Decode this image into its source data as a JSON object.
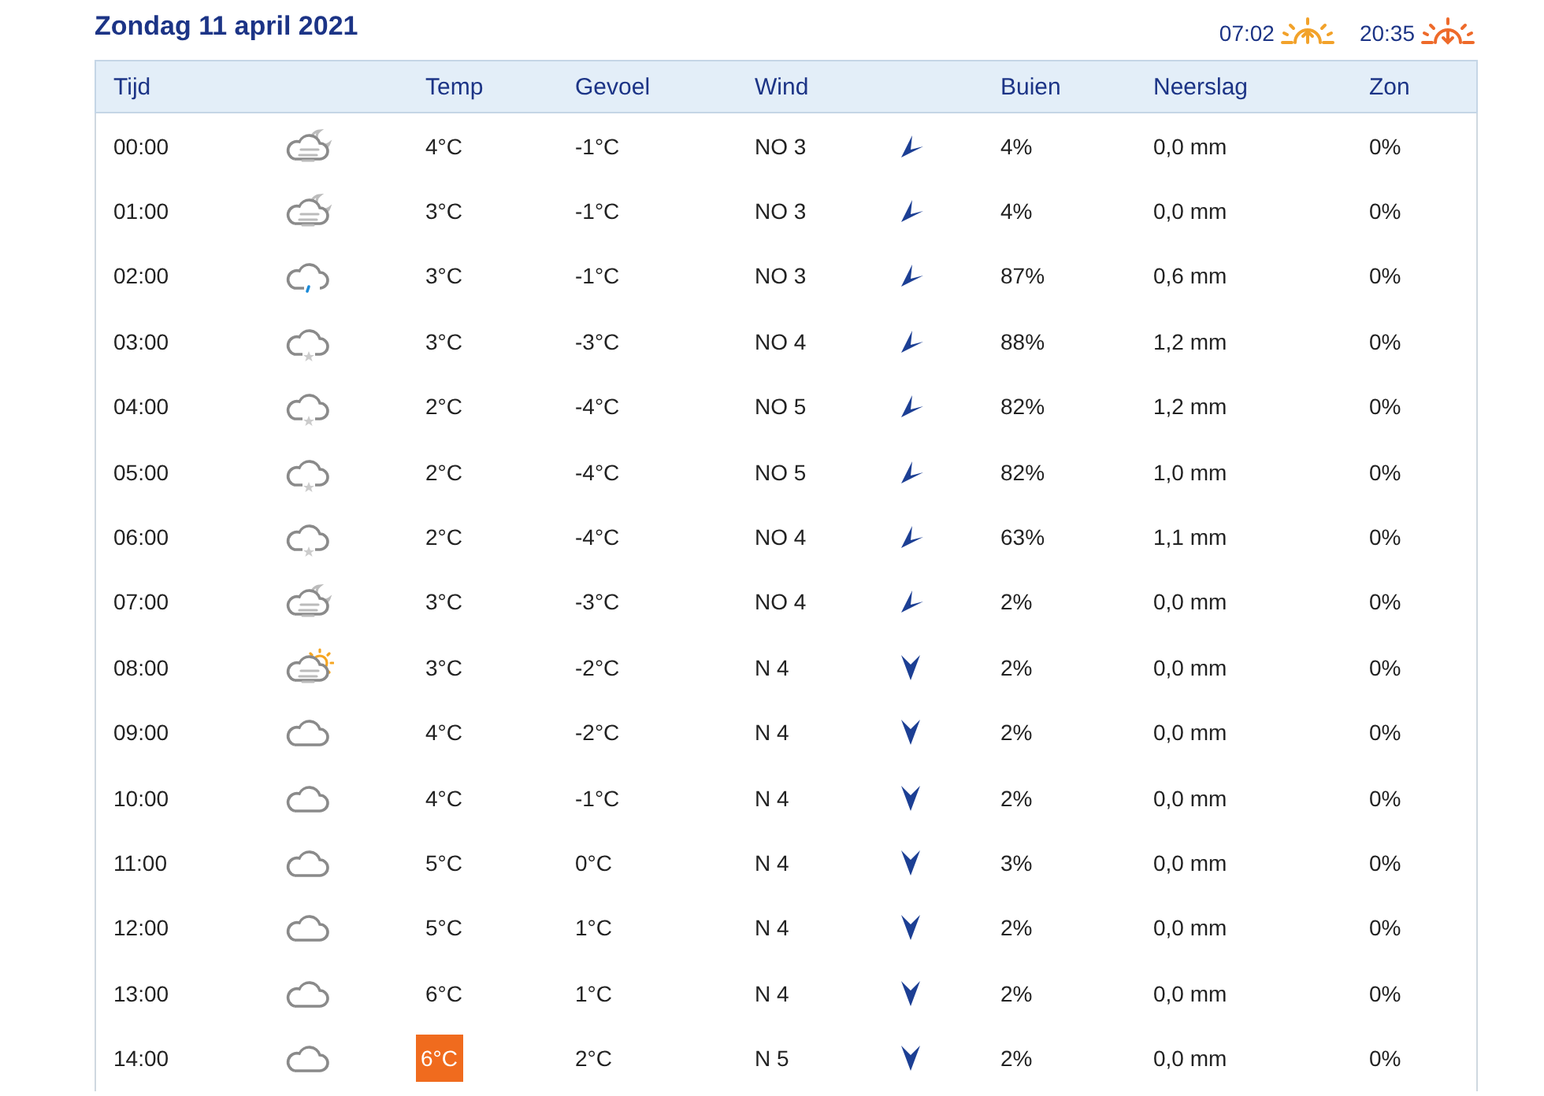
{
  "title": "Zondag 11 april 2021",
  "sun": [
    {
      "kind": "sunrise",
      "time": "07:02"
    },
    {
      "kind": "sunset",
      "time": "20:35"
    }
  ],
  "table": {
    "columns": [
      "Tijd",
      "Temp",
      "Gevoel",
      "Wind",
      "Buien",
      "Neerslag",
      "Zon"
    ],
    "rows": [
      {
        "time": "00:00",
        "weather": {
          "kind": "fog-night"
        },
        "temp": "4°C",
        "highlight": false,
        "feel": "-1°C",
        "wind": "NO 3",
        "wind_arrow": {
          "kind": "ne"
        },
        "showers": "4%",
        "precip": "0,0 mm",
        "sun": "0%"
      },
      {
        "time": "01:00",
        "weather": {
          "kind": "fog-night"
        },
        "temp": "3°C",
        "highlight": false,
        "feel": "-1°C",
        "wind": "NO 3",
        "wind_arrow": {
          "kind": "ne"
        },
        "showers": "4%",
        "precip": "0,0 mm",
        "sun": "0%"
      },
      {
        "time": "02:00",
        "weather": {
          "kind": "rain"
        },
        "temp": "3°C",
        "highlight": false,
        "feel": "-1°C",
        "wind": "NO 3",
        "wind_arrow": {
          "kind": "ne"
        },
        "showers": "87%",
        "precip": "0,6 mm",
        "sun": "0%"
      },
      {
        "time": "03:00",
        "weather": {
          "kind": "snow"
        },
        "temp": "3°C",
        "highlight": false,
        "feel": "-3°C",
        "wind": "NO 4",
        "wind_arrow": {
          "kind": "ne"
        },
        "showers": "88%",
        "precip": "1,2 mm",
        "sun": "0%"
      },
      {
        "time": "04:00",
        "weather": {
          "kind": "snow"
        },
        "temp": "2°C",
        "highlight": false,
        "feel": "-4°C",
        "wind": "NO 5",
        "wind_arrow": {
          "kind": "ne"
        },
        "showers": "82%",
        "precip": "1,2 mm",
        "sun": "0%"
      },
      {
        "time": "05:00",
        "weather": {
          "kind": "snow"
        },
        "temp": "2°C",
        "highlight": false,
        "feel": "-4°C",
        "wind": "NO 5",
        "wind_arrow": {
          "kind": "ne"
        },
        "showers": "82%",
        "precip": "1,0 mm",
        "sun": "0%"
      },
      {
        "time": "06:00",
        "weather": {
          "kind": "snow"
        },
        "temp": "2°C",
        "highlight": false,
        "feel": "-4°C",
        "wind": "NO 4",
        "wind_arrow": {
          "kind": "ne"
        },
        "showers": "63%",
        "precip": "1,1 mm",
        "sun": "0%"
      },
      {
        "time": "07:00",
        "weather": {
          "kind": "fog-night"
        },
        "temp": "3°C",
        "highlight": false,
        "feel": "-3°C",
        "wind": "NO 4",
        "wind_arrow": {
          "kind": "ne"
        },
        "showers": "2%",
        "precip": "0,0 mm",
        "sun": "0%"
      },
      {
        "time": "08:00",
        "weather": {
          "kind": "fog-day"
        },
        "temp": "3°C",
        "highlight": false,
        "feel": "-2°C",
        "wind": "N 4",
        "wind_arrow": {
          "kind": "n"
        },
        "showers": "2%",
        "precip": "0,0 mm",
        "sun": "0%"
      },
      {
        "time": "09:00",
        "weather": {
          "kind": "cloud"
        },
        "temp": "4°C",
        "highlight": false,
        "feel": "-2°C",
        "wind": "N 4",
        "wind_arrow": {
          "kind": "n"
        },
        "showers": "2%",
        "precip": "0,0 mm",
        "sun": "0%"
      },
      {
        "time": "10:00",
        "weather": {
          "kind": "cloud"
        },
        "temp": "4°C",
        "highlight": false,
        "feel": "-1°C",
        "wind": "N 4",
        "wind_arrow": {
          "kind": "n"
        },
        "showers": "2%",
        "precip": "0,0 mm",
        "sun": "0%"
      },
      {
        "time": "11:00",
        "weather": {
          "kind": "cloud"
        },
        "temp": "5°C",
        "highlight": false,
        "feel": "0°C",
        "wind": "N 4",
        "wind_arrow": {
          "kind": "n"
        },
        "showers": "3%",
        "precip": "0,0 mm",
        "sun": "0%"
      },
      {
        "time": "12:00",
        "weather": {
          "kind": "cloud"
        },
        "temp": "5°C",
        "highlight": false,
        "feel": "1°C",
        "wind": "N 4",
        "wind_arrow": {
          "kind": "n"
        },
        "showers": "2%",
        "precip": "0,0 mm",
        "sun": "0%"
      },
      {
        "time": "13:00",
        "weather": {
          "kind": "cloud"
        },
        "temp": "6°C",
        "highlight": false,
        "feel": "1°C",
        "wind": "N 4",
        "wind_arrow": {
          "kind": "n"
        },
        "showers": "2%",
        "precip": "0,0 mm",
        "sun": "0%"
      },
      {
        "time": "14:00",
        "weather": {
          "kind": "cloud"
        },
        "temp": "6°C",
        "highlight": true,
        "feel": "2°C",
        "wind": "N 5",
        "wind_arrow": {
          "kind": "n"
        },
        "showers": "2%",
        "precip": "0,0 mm",
        "sun": "0%"
      }
    ]
  }
}
